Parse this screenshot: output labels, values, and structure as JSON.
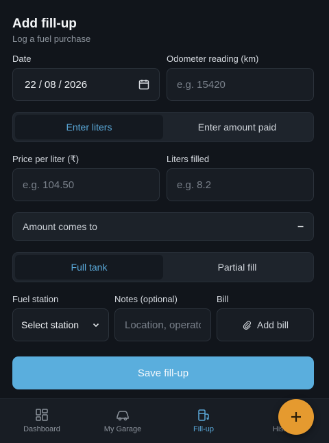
{
  "header": {
    "title": "Add fill-up",
    "subtitle": "Log a fuel purchase"
  },
  "date": {
    "label": "Date",
    "day": "22",
    "month": "08",
    "year": "2026",
    "sep": "/"
  },
  "odometer": {
    "label": "Odometer reading (km)",
    "placeholder": "e.g. 15420"
  },
  "mode_toggle": {
    "options": [
      "Enter liters",
      "Enter amount paid"
    ],
    "selected": "Enter liters"
  },
  "price": {
    "label": "Price per liter (₹)",
    "placeholder": "e.g. 104.50"
  },
  "liters": {
    "label": "Liters filled",
    "placeholder": "e.g. 8.2"
  },
  "amount": {
    "label": "Amount comes to",
    "value": "–"
  },
  "fill_toggle": {
    "options": [
      "Full tank",
      "Partial fill"
    ],
    "selected": "Full tank"
  },
  "station": {
    "label": "Fuel station",
    "value": "Select station"
  },
  "notes": {
    "label": "Notes (optional)",
    "placeholder": "Location, operator..."
  },
  "bill": {
    "label": "Bill",
    "button": "Add bill",
    "icon": "paperclip-icon"
  },
  "save_label": "Save fill-up",
  "nav": {
    "items": [
      {
        "label": "Dashboard",
        "icon": "dashboard-icon"
      },
      {
        "label": "My Garage",
        "icon": "car-icon"
      },
      {
        "label": "Fill-up",
        "icon": "fuel-icon"
      },
      {
        "label": "History",
        "icon": "history-icon"
      }
    ],
    "active": "Fill-up"
  },
  "fab": {
    "icon": "plus-icon"
  },
  "colors": {
    "accent": "#5aa8d8",
    "save": "#5aaedd",
    "fab": "#e59a2f",
    "background": "#11151b"
  }
}
